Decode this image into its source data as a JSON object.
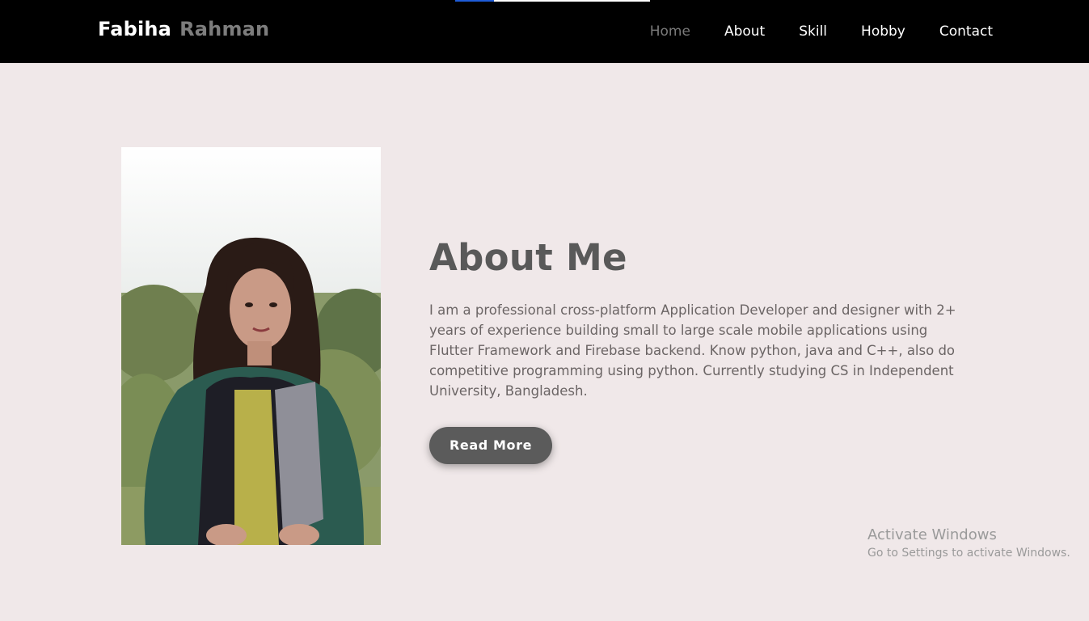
{
  "header": {
    "logo_first": "Fabiha",
    "logo_last": "Rahman",
    "nav": [
      {
        "label": "Home",
        "active": true
      },
      {
        "label": "About",
        "active": false
      },
      {
        "label": "Skill",
        "active": false
      },
      {
        "label": "Hobby",
        "active": false
      },
      {
        "label": "Contact",
        "active": false
      }
    ]
  },
  "about": {
    "title": "About Me",
    "description": "I am a professional cross-platform Application Developer and designer with 2+ years of experience building small to large scale mobile applications using Flutter Framework and Firebase backend. Know python, java and C++, also do competitive programming using python. Currently studying CS in Independent University, Bangladesh.",
    "button_label": "Read More"
  },
  "watermark": {
    "title": "Activate Windows",
    "subtitle": "Go to Settings to activate Windows."
  },
  "colors": {
    "background": "#f0e8e9",
    "header": "#000000",
    "button": "#5b5b5b"
  }
}
